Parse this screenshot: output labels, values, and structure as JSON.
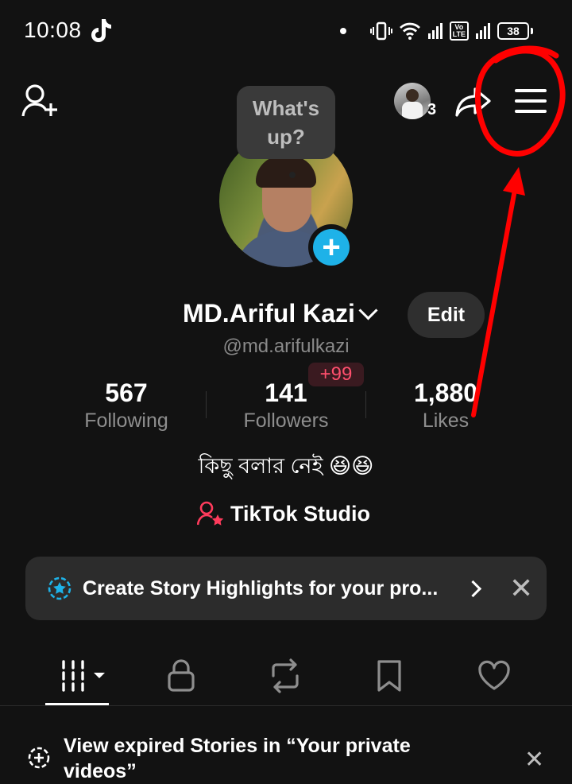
{
  "status_bar": {
    "time": "10:08",
    "volte_label": "Vo LTE",
    "battery": "38"
  },
  "top_bar": {
    "notification_count": "3"
  },
  "profile": {
    "bubble_text": "What's up?",
    "display_name": "MD.Ariful Kazi",
    "edit_label": "Edit",
    "username": "@md.arifulkazi",
    "bio": "কিছু বলার নেই 😆😆",
    "studio_label": "TikTok Studio"
  },
  "stats": [
    {
      "value": "567",
      "label": "Following"
    },
    {
      "value": "141",
      "label": "Followers",
      "badge": "+99"
    },
    {
      "value": "1,880",
      "label": "Likes"
    }
  ],
  "banner": {
    "text": "Create Story Highlights for your pro...",
    "close": "✕"
  },
  "tabs": [
    "videos-grid-icon",
    "lock-icon",
    "repost-icon",
    "bookmark-icon",
    "heart-icon"
  ],
  "expired": {
    "text": "View expired Stories in “Your private videos”",
    "close": "✕"
  },
  "colors": {
    "background": "#121212",
    "accent_blue": "#1eb2e8",
    "accent_red": "#ff3b5c",
    "annotation_red": "#ff0000"
  }
}
